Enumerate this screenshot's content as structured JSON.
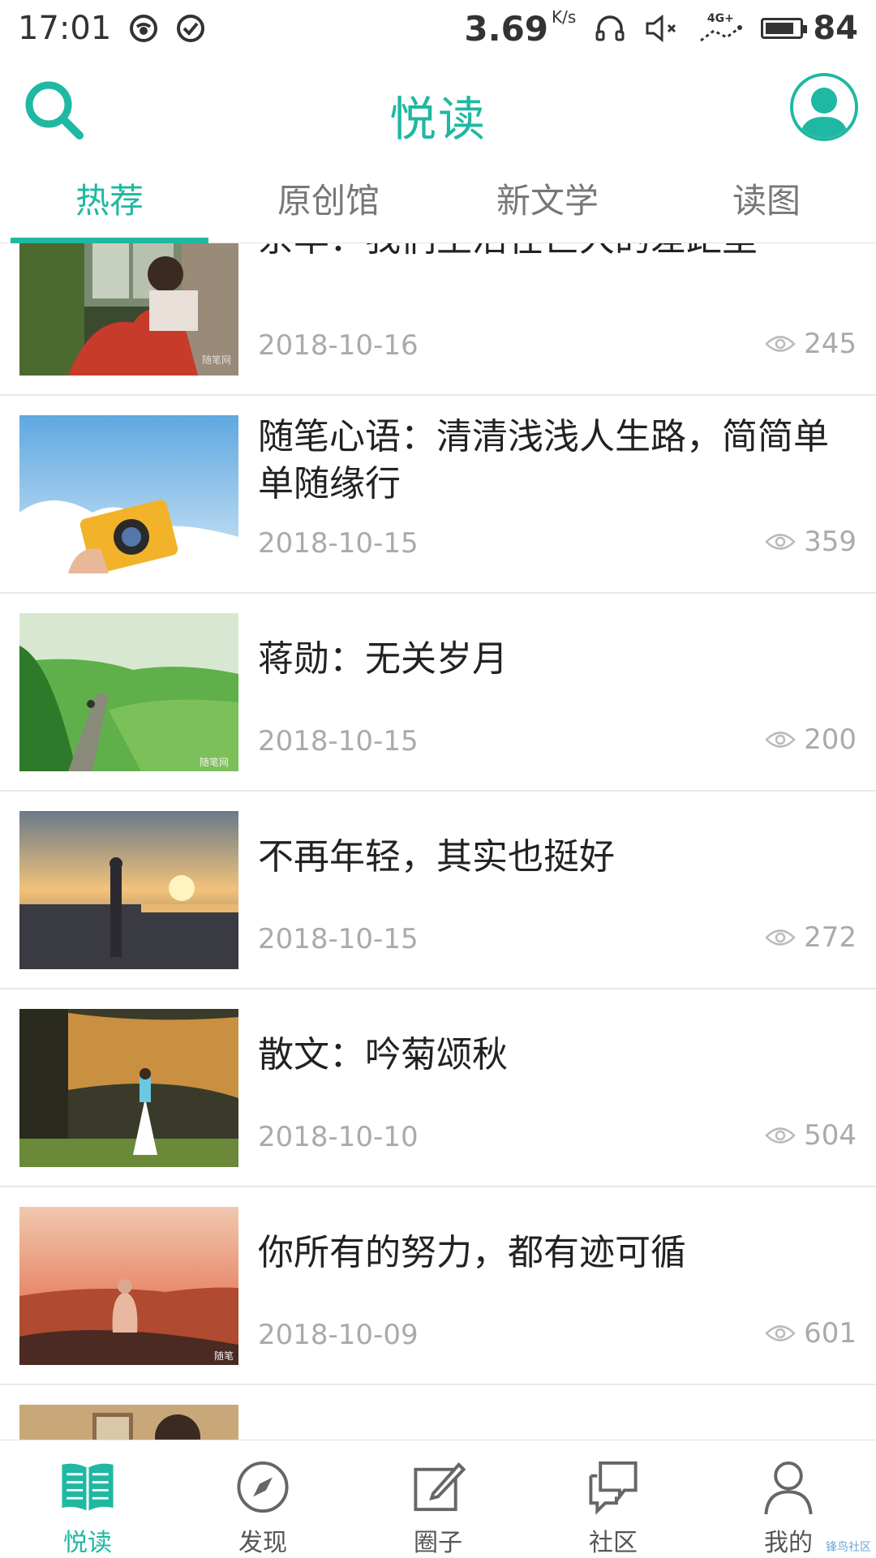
{
  "status_bar": {
    "time": "17:01",
    "speed": "3.69",
    "speed_unit": "K/s",
    "network": "4G+",
    "battery": "84",
    "battery_percent": 84
  },
  "header": {
    "title": "悦读"
  },
  "tabs": [
    {
      "label": "热荐",
      "active": true
    },
    {
      "label": "原创馆",
      "active": false
    },
    {
      "label": "新文学",
      "active": false
    },
    {
      "label": "读图",
      "active": false
    }
  ],
  "articles": [
    {
      "title": "余华：我们生活在巨大的差距里",
      "date": "2018-10-16",
      "views": "245",
      "thumb_watermark": "随笔网"
    },
    {
      "title": "随笔心语：清清浅浅人生路，简简单单随缘行",
      "date": "2018-10-15",
      "views": "359"
    },
    {
      "title": "蒋勋：无关岁月",
      "date": "2018-10-15",
      "views": "200",
      "thumb_watermark": "随笔网"
    },
    {
      "title": "不再年轻，其实也挺好",
      "date": "2018-10-15",
      "views": "272"
    },
    {
      "title": "散文：吟菊颂秋",
      "date": "2018-10-10",
      "views": "504"
    },
    {
      "title": "你所有的努力，都有迹可循",
      "date": "2018-10-09",
      "views": "601",
      "thumb_watermark": "随笔"
    }
  ],
  "bottom_nav": [
    {
      "label": "悦读",
      "icon": "book-icon",
      "active": true
    },
    {
      "label": "发现",
      "icon": "compass-icon",
      "active": false
    },
    {
      "label": "圈子",
      "icon": "edit-icon",
      "active": false
    },
    {
      "label": "社区",
      "icon": "chat-icon",
      "active": false
    },
    {
      "label": "我的",
      "icon": "user-icon",
      "active": false
    }
  ],
  "watermark": "锋鸟社区",
  "colors": {
    "accent": "#1fb8a2",
    "muted": "#aaaaaa",
    "divider": "#e8e8e8"
  }
}
